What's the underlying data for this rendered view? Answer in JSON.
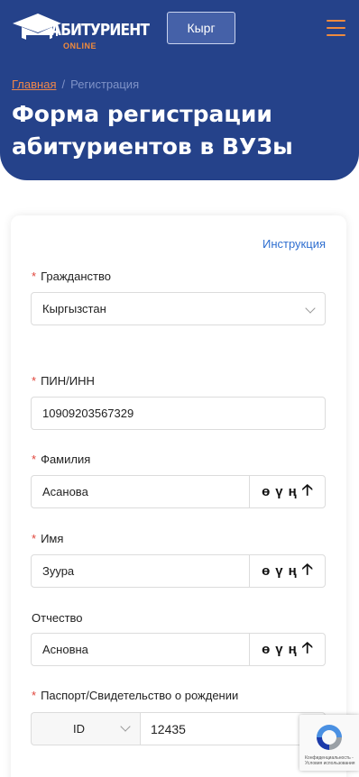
{
  "header": {
    "logo_text": "АБИТУРИЕНТ",
    "logo_sub": "ONLINE",
    "language_button": "Кырг",
    "colors": {
      "primary": "#25428a",
      "accent": "#ef8a3e"
    }
  },
  "breadcrumb": {
    "home": "Главная",
    "separator": "/",
    "current": "Регистрация"
  },
  "page_title": "Форма регистрации абитуриентов в ВУЗы",
  "form": {
    "instructions_link": "Инструкция",
    "required_mark": "*",
    "citizenship": {
      "label": "Гражданство",
      "value": "Кыргызстан"
    },
    "pin": {
      "label": "ПИН/ИНН",
      "value": "10909203567329"
    },
    "last_name": {
      "label": "Фамилия",
      "value": "Асанова"
    },
    "first_name": {
      "label": "Имя",
      "value": "Зуура"
    },
    "patronymic": {
      "label": "Отчество",
      "value": "Асновна"
    },
    "passport": {
      "label": "Паспорт/Свидетельство о рождении",
      "type": "ID",
      "number": "12435"
    },
    "special_chars": {
      "o": "ө",
      "u": "ү",
      "n": "ң",
      "shift": "🡡"
    }
  },
  "recaptcha": {
    "text": "Конфиденциальность - Условия использования"
  }
}
